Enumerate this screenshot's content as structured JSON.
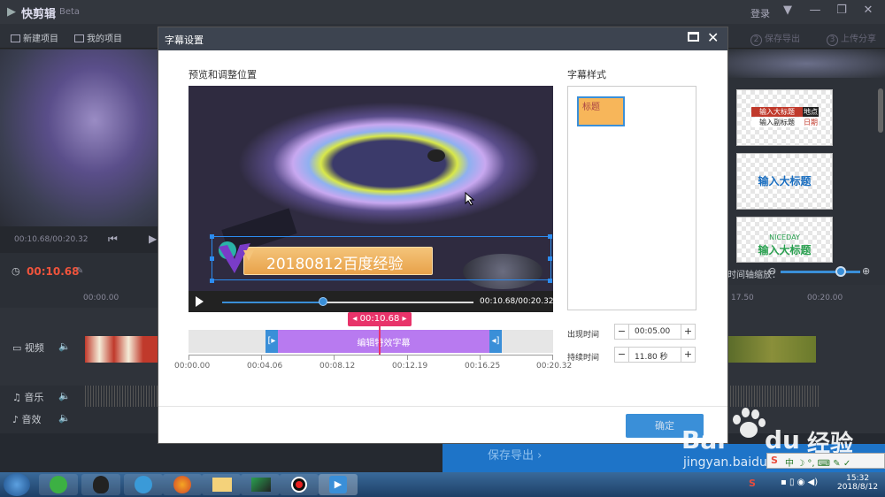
{
  "app": {
    "title": "快剪辑",
    "beta": "Beta",
    "login": "登录"
  },
  "toolbar": {
    "new_project": "新建项目",
    "my_projects": "我的项目",
    "step2": "保存导出",
    "step3": "上传分享",
    "step2_num": "2",
    "step3_num": "3"
  },
  "left": {
    "time": "00:10.68/00:20.32",
    "current_time": "00:10.68",
    "ruler_start": "00:00.00"
  },
  "tracks": {
    "video": "视频",
    "music": "音乐",
    "sfx": "音效"
  },
  "right": {
    "tpl1_title": "输入大标题",
    "tpl1_sub": "输入副标题",
    "tpl1_tag1": "地点",
    "tpl1_tag2": "日期",
    "tpl2_title": "输入大标题",
    "tpl3_small": "NICEDAY",
    "tpl3_title": "输入大标题",
    "zoom_label": "时间轴缩放：",
    "ruler1": "17.50",
    "ruler2": "00:20.00"
  },
  "export": {
    "label": "保存导出"
  },
  "dialog": {
    "title": "字幕设置",
    "preview_label": "预览和调整位置",
    "caption_text": "20180812百度经验",
    "time_display": "00:10.68/00:20.32",
    "flag_time": "00:10.68",
    "clip_label": "编辑特效字幕",
    "ruler": [
      "00:00.00",
      "00:04.06",
      "00:08.12",
      "00:12.19",
      "00:16.25",
      "00:20.32"
    ],
    "style_label": "字幕样式",
    "style_item": "标题",
    "appear_label": "出现时间",
    "appear_value": "00:05.00",
    "duration_label": "持续时间",
    "duration_value": "11.80 秒",
    "ok": "确定",
    "colors": {
      "accent": "#3a8fd8",
      "clip": "#b87af0",
      "playhead": "#e8336a",
      "caption": "#f7b65a"
    }
  },
  "watermark": {
    "brand": "Bai",
    "du": "du",
    "jingyan": "经验",
    "url": "jingyan.baidu.com"
  },
  "taskbar": {
    "time": "15:32",
    "date": "2018/8/12"
  }
}
